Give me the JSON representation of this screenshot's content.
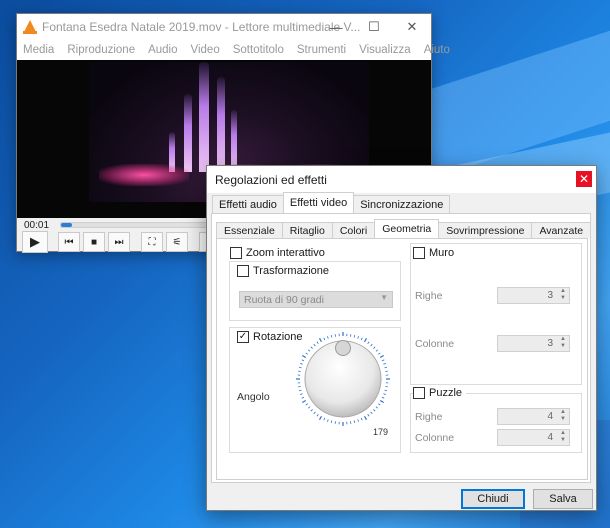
{
  "desktop": {
    "accent": "#1565c0"
  },
  "vlc": {
    "title": "Fontana Esedra Natale 2019.mov - Lettore multimediale V...",
    "window_controls": [
      "—",
      "☐",
      "✕"
    ],
    "menu": [
      "Media",
      "Riproduzione",
      "Audio",
      "Video",
      "Sottotitolo",
      "Strumenti",
      "Visualizza",
      "Aiuto"
    ],
    "time": "00:01",
    "progress_fraction": 0.03,
    "controls": {
      "play": "▶",
      "prev": "⏮",
      "stop": "■",
      "next": "⏭",
      "fullscreen": "⛶",
      "extended": "⚟",
      "playlist": "☰"
    }
  },
  "dialog": {
    "title": "Regolazioni ed effetti",
    "close": "✕",
    "outer_tabs": [
      "Effetti audio",
      "Effetti video",
      "Sincronizzazione"
    ],
    "inner_tabs": [
      "Essenziale",
      "Ritaglio",
      "Colori",
      "Geometria",
      "Sovrimpressione",
      "Avanzate"
    ],
    "geometry": {
      "zoom_label": "Zoom interattivo",
      "zoom_checked": false,
      "transform_label": "Trasformazione",
      "transform_checked": false,
      "transform_value": "Ruota di 90 gradi",
      "rotation_label": "Rotazione",
      "rotation_checked": true,
      "angle_label": "Angolo",
      "angle_value": "179",
      "wall_label": "Muro",
      "wall_checked": false,
      "wall_rows_label": "Righe",
      "wall_rows": "3",
      "wall_cols_label": "Colonne",
      "wall_cols": "3",
      "puzzle_label": "Puzzle",
      "puzzle_checked": false,
      "puzzle_rows_label": "Righe",
      "puzzle_rows": "4",
      "puzzle_cols_label": "Colonne",
      "puzzle_cols": "4"
    },
    "buttons": {
      "close": "Chiudi",
      "save": "Salva"
    }
  }
}
